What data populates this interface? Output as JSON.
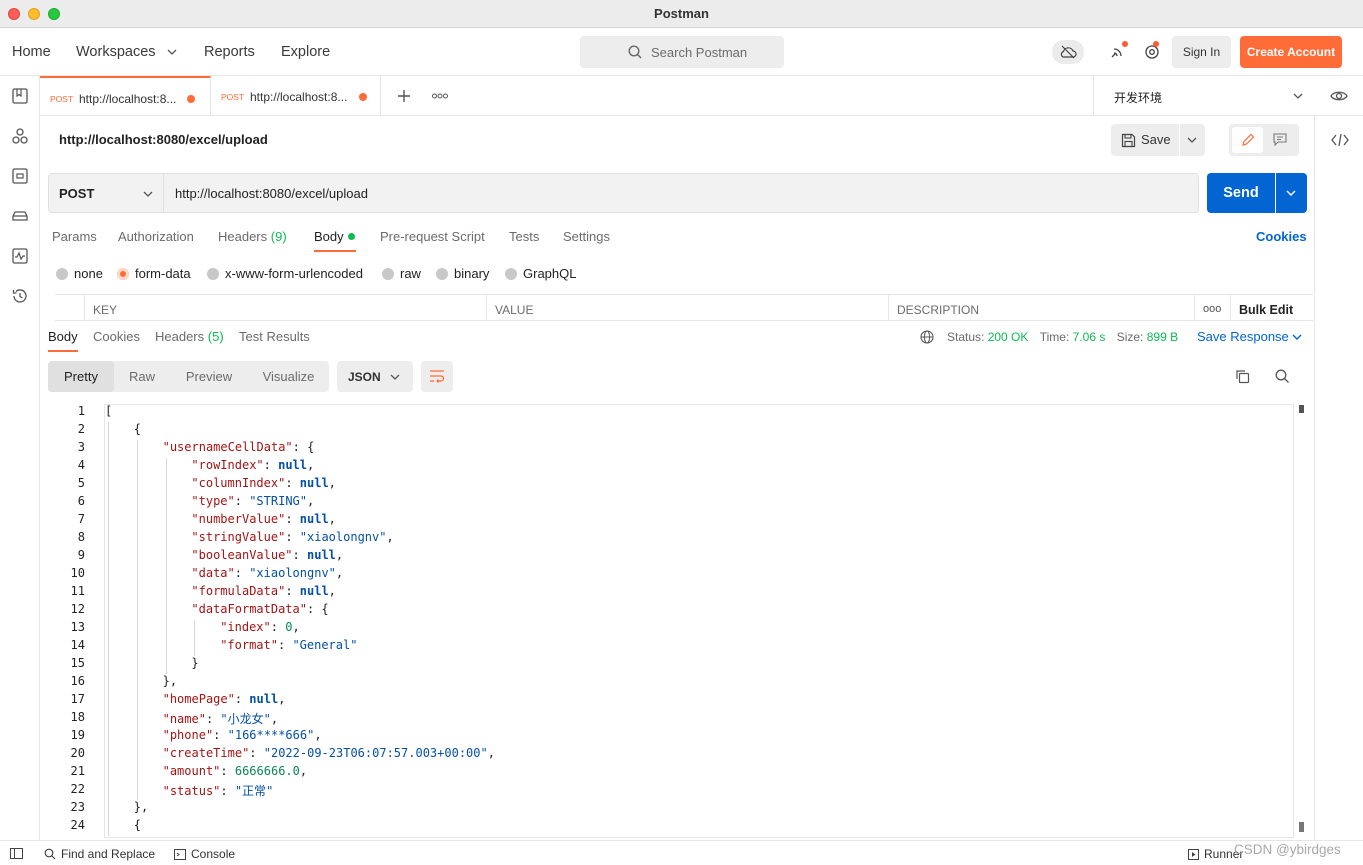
{
  "window": {
    "title": "Postman"
  },
  "nav": {
    "home": "Home",
    "workspaces": "Workspaces",
    "reports": "Reports",
    "explore": "Explore",
    "search_placeholder": "Search Postman",
    "sign_in": "Sign In",
    "create_account": "Create Account"
  },
  "tabs": [
    {
      "method": "POST",
      "url": "http://localhost:8...",
      "unsaved": true
    },
    {
      "method": "POST",
      "url": "http://localhost:8...",
      "unsaved": true
    }
  ],
  "environment": {
    "name": "开发环境"
  },
  "request": {
    "title": "http://localhost:8080/excel/upload",
    "method": "POST",
    "url": "http://localhost:8080/excel/upload",
    "save_label": "Save",
    "send_label": "Send"
  },
  "request_tabs": {
    "params": "Params",
    "authorization": "Authorization",
    "headers": "Headers",
    "headers_count": "(9)",
    "body": "Body",
    "pre_request": "Pre-request Script",
    "tests": "Tests",
    "settings": "Settings",
    "cookies": "Cookies"
  },
  "body_types": {
    "none": "none",
    "form_data": "form-data",
    "urlencoded": "x-www-form-urlencoded",
    "raw": "raw",
    "binary": "binary",
    "graphql": "GraphQL",
    "selected": "form-data"
  },
  "kv_table": {
    "key": "KEY",
    "value": "VALUE",
    "description": "DESCRIPTION",
    "more": "ooo",
    "bulk_edit": "Bulk Edit"
  },
  "response": {
    "tabs": {
      "body": "Body",
      "cookies": "Cookies",
      "headers": "Headers",
      "headers_count": "(5)",
      "test_results": "Test Results"
    },
    "status_label": "Status:",
    "status": "200 OK",
    "time_label": "Time:",
    "time": "7.06 s",
    "size_label": "Size:",
    "size": "899 B",
    "save_response": "Save Response",
    "views": {
      "pretty": "Pretty",
      "raw": "Raw",
      "preview": "Preview",
      "visualize": "Visualize"
    },
    "format": "JSON"
  },
  "code_lines": [
    {
      "n": "1",
      "indent": 0,
      "parts": [
        [
          "p",
          "["
        ]
      ]
    },
    {
      "n": "2",
      "indent": 1,
      "parts": [
        [
          "p",
          "{"
        ]
      ]
    },
    {
      "n": "3",
      "indent": 2,
      "parts": [
        [
          "k",
          "\"usernameCellData\""
        ],
        [
          "p",
          ": {"
        ]
      ]
    },
    {
      "n": "4",
      "indent": 3,
      "parts": [
        [
          "k",
          "\"rowIndex\""
        ],
        [
          "p",
          ": "
        ],
        [
          "b",
          "null"
        ],
        [
          "p",
          ","
        ]
      ]
    },
    {
      "n": "5",
      "indent": 3,
      "parts": [
        [
          "k",
          "\"columnIndex\""
        ],
        [
          "p",
          ": "
        ],
        [
          "b",
          "null"
        ],
        [
          "p",
          ","
        ]
      ]
    },
    {
      "n": "6",
      "indent": 3,
      "parts": [
        [
          "k",
          "\"type\""
        ],
        [
          "p",
          ": "
        ],
        [
          "s",
          "\"STRING\""
        ],
        [
          "p",
          ","
        ]
      ]
    },
    {
      "n": "7",
      "indent": 3,
      "parts": [
        [
          "k",
          "\"numberValue\""
        ],
        [
          "p",
          ": "
        ],
        [
          "b",
          "null"
        ],
        [
          "p",
          ","
        ]
      ]
    },
    {
      "n": "8",
      "indent": 3,
      "parts": [
        [
          "k",
          "\"stringValue\""
        ],
        [
          "p",
          ": "
        ],
        [
          "s",
          "\"xiaolongnv\""
        ],
        [
          "p",
          ","
        ]
      ]
    },
    {
      "n": "9",
      "indent": 3,
      "parts": [
        [
          "k",
          "\"booleanValue\""
        ],
        [
          "p",
          ": "
        ],
        [
          "b",
          "null"
        ],
        [
          "p",
          ","
        ]
      ]
    },
    {
      "n": "10",
      "indent": 3,
      "parts": [
        [
          "k",
          "\"data\""
        ],
        [
          "p",
          ": "
        ],
        [
          "s",
          "\"xiaolongnv\""
        ],
        [
          "p",
          ","
        ]
      ]
    },
    {
      "n": "11",
      "indent": 3,
      "parts": [
        [
          "k",
          "\"formulaData\""
        ],
        [
          "p",
          ": "
        ],
        [
          "b",
          "null"
        ],
        [
          "p",
          ","
        ]
      ]
    },
    {
      "n": "12",
      "indent": 3,
      "parts": [
        [
          "k",
          "\"dataFormatData\""
        ],
        [
          "p",
          ": {"
        ]
      ]
    },
    {
      "n": "13",
      "indent": 4,
      "parts": [
        [
          "k",
          "\"index\""
        ],
        [
          "p",
          ": "
        ],
        [
          "n",
          "0"
        ],
        [
          "p",
          ","
        ]
      ]
    },
    {
      "n": "14",
      "indent": 4,
      "parts": [
        [
          "k",
          "\"format\""
        ],
        [
          "p",
          ": "
        ],
        [
          "s",
          "\"General\""
        ]
      ]
    },
    {
      "n": "15",
      "indent": 3,
      "parts": [
        [
          "p",
          "}"
        ]
      ]
    },
    {
      "n": "16",
      "indent": 2,
      "parts": [
        [
          "p",
          "},"
        ]
      ]
    },
    {
      "n": "17",
      "indent": 2,
      "parts": [
        [
          "k",
          "\"homePage\""
        ],
        [
          "p",
          ": "
        ],
        [
          "b",
          "null"
        ],
        [
          "p",
          ","
        ]
      ]
    },
    {
      "n": "18",
      "indent": 2,
      "parts": [
        [
          "k",
          "\"name\""
        ],
        [
          "p",
          ": "
        ],
        [
          "s",
          "\"小龙女\""
        ],
        [
          "p",
          ","
        ]
      ]
    },
    {
      "n": "19",
      "indent": 2,
      "parts": [
        [
          "k",
          "\"phone\""
        ],
        [
          "p",
          ": "
        ],
        [
          "s",
          "\"166****666\""
        ],
        [
          "p",
          ","
        ]
      ]
    },
    {
      "n": "20",
      "indent": 2,
      "parts": [
        [
          "k",
          "\"createTime\""
        ],
        [
          "p",
          ": "
        ],
        [
          "s",
          "\"2022-09-23T06:07:57.003+00:00\""
        ],
        [
          "p",
          ","
        ]
      ]
    },
    {
      "n": "21",
      "indent": 2,
      "parts": [
        [
          "k",
          "\"amount\""
        ],
        [
          "p",
          ": "
        ],
        [
          "n",
          "6666666.0"
        ],
        [
          "p",
          ","
        ]
      ]
    },
    {
      "n": "22",
      "indent": 2,
      "parts": [
        [
          "k",
          "\"status\""
        ],
        [
          "p",
          ": "
        ],
        [
          "s",
          "\"正常\""
        ]
      ]
    },
    {
      "n": "23",
      "indent": 1,
      "parts": [
        [
          "p",
          "},"
        ]
      ]
    },
    {
      "n": "24",
      "indent": 1,
      "parts": [
        [
          "p",
          "{"
        ]
      ]
    }
  ],
  "statusbar": {
    "find_replace": "Find and Replace",
    "console": "Console",
    "runner": "Runner",
    "watermark": "CSDN @ybirdges"
  },
  "colors": {
    "accent": "#ff6c37",
    "primary": "#0265d2",
    "success": "#0cbb52"
  }
}
